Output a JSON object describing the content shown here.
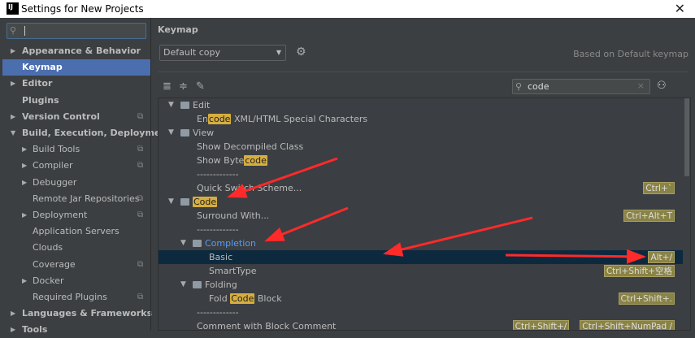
{
  "window": {
    "title": "Settings for New Projects",
    "logo": "IJ"
  },
  "sidebar": {
    "search_value": "",
    "items": [
      {
        "label": "Appearance & Behavior",
        "level": 0,
        "bold": true,
        "expander": "right",
        "copy": false
      },
      {
        "label": "Keymap",
        "level": 0,
        "bold": true,
        "expander": "",
        "copy": false,
        "selected": true
      },
      {
        "label": "Editor",
        "level": 0,
        "bold": true,
        "expander": "right",
        "copy": false
      },
      {
        "label": "Plugins",
        "level": 0,
        "bold": true,
        "expander": "",
        "copy": false
      },
      {
        "label": "Version Control",
        "level": 0,
        "bold": true,
        "expander": "right",
        "copy": true
      },
      {
        "label": "Build, Execution, Deployment",
        "level": 0,
        "bold": true,
        "expander": "down",
        "copy": false
      },
      {
        "label": "Build Tools",
        "level": 1,
        "expander": "right",
        "copy": true
      },
      {
        "label": "Compiler",
        "level": 1,
        "expander": "right",
        "copy": true
      },
      {
        "label": "Debugger",
        "level": 1,
        "expander": "right",
        "copy": false
      },
      {
        "label": "Remote Jar Repositories",
        "level": 1,
        "expander": "",
        "copy": true
      },
      {
        "label": "Deployment",
        "level": 1,
        "expander": "right",
        "copy": true
      },
      {
        "label": "Application Servers",
        "level": 1,
        "expander": "",
        "copy": false
      },
      {
        "label": "Clouds",
        "level": 1,
        "expander": "",
        "copy": false
      },
      {
        "label": "Coverage",
        "level": 1,
        "expander": "",
        "copy": true
      },
      {
        "label": "Docker",
        "level": 1,
        "expander": "right",
        "copy": false
      },
      {
        "label": "Required Plugins",
        "level": 1,
        "expander": "",
        "copy": true
      },
      {
        "label": "Languages & Frameworks",
        "level": 0,
        "bold": true,
        "expander": "right",
        "copy": false
      },
      {
        "label": "Tools",
        "level": 0,
        "bold": true,
        "expander": "right",
        "copy": false
      }
    ]
  },
  "main": {
    "heading": "Keymap",
    "keymap_select": "Default copy",
    "based_on": "Based on Default keymap",
    "filter_value": "code",
    "tree": [
      {
        "level": 0,
        "folder": true,
        "parts": [
          [
            "Edit",
            false
          ]
        ]
      },
      {
        "level": 1,
        "parts": [
          [
            "En",
            false
          ],
          [
            "code",
            true
          ],
          [
            " XML/HTML Special Characters",
            false
          ]
        ]
      },
      {
        "level": 0,
        "folder": true,
        "parts": [
          [
            "View",
            false
          ]
        ]
      },
      {
        "level": 1,
        "parts": [
          [
            "Show Decompiled Class",
            false
          ]
        ]
      },
      {
        "level": 1,
        "parts": [
          [
            "Show Byte",
            false
          ],
          [
            "code",
            true
          ]
        ]
      },
      {
        "level": 1,
        "parts": [
          [
            "-------------",
            false
          ]
        ]
      },
      {
        "level": 1,
        "parts": [
          [
            "Quick Switch Scheme...",
            false
          ]
        ],
        "shortcuts": [
          "Ctrl+`"
        ]
      },
      {
        "level": 0,
        "folder": true,
        "parts": [
          [
            "Code",
            true
          ]
        ]
      },
      {
        "level": 1,
        "parts": [
          [
            "Surround With...",
            false
          ]
        ],
        "shortcuts": [
          "Ctrl+Alt+T"
        ]
      },
      {
        "level": 1,
        "parts": [
          [
            "-------------",
            false
          ]
        ]
      },
      {
        "level": 1,
        "folder": true,
        "blue": true,
        "parts": [
          [
            "Completion",
            false
          ]
        ]
      },
      {
        "level": 2,
        "selected": true,
        "parts": [
          [
            "Basic",
            false
          ]
        ],
        "shortcuts": [
          "Alt+/"
        ]
      },
      {
        "level": 2,
        "parts": [
          [
            "SmartType",
            false
          ]
        ],
        "shortcuts": [
          "Ctrl+Shift+空格"
        ]
      },
      {
        "level": 1,
        "folder": true,
        "parts": [
          [
            "Folding",
            false
          ]
        ]
      },
      {
        "level": 2,
        "parts": [
          [
            "Fold ",
            false
          ],
          [
            "Code",
            true
          ],
          [
            " Block",
            false
          ]
        ],
        "shortcuts": [
          "Ctrl+Shift+."
        ]
      },
      {
        "level": 1,
        "parts": [
          [
            "-------------",
            false
          ]
        ]
      },
      {
        "level": 1,
        "parts": [
          [
            "Comment with Block Comment",
            false
          ]
        ],
        "shortcuts": [
          "Ctrl+Shift+/",
          "Ctrl+Shift+NumPad /"
        ]
      }
    ]
  },
  "colors": {
    "selection": "#4b6eaf",
    "tree_selection": "#0d293e",
    "highlight": "#d6ae3f",
    "annotation_arrow": "#ff2a2a"
  }
}
